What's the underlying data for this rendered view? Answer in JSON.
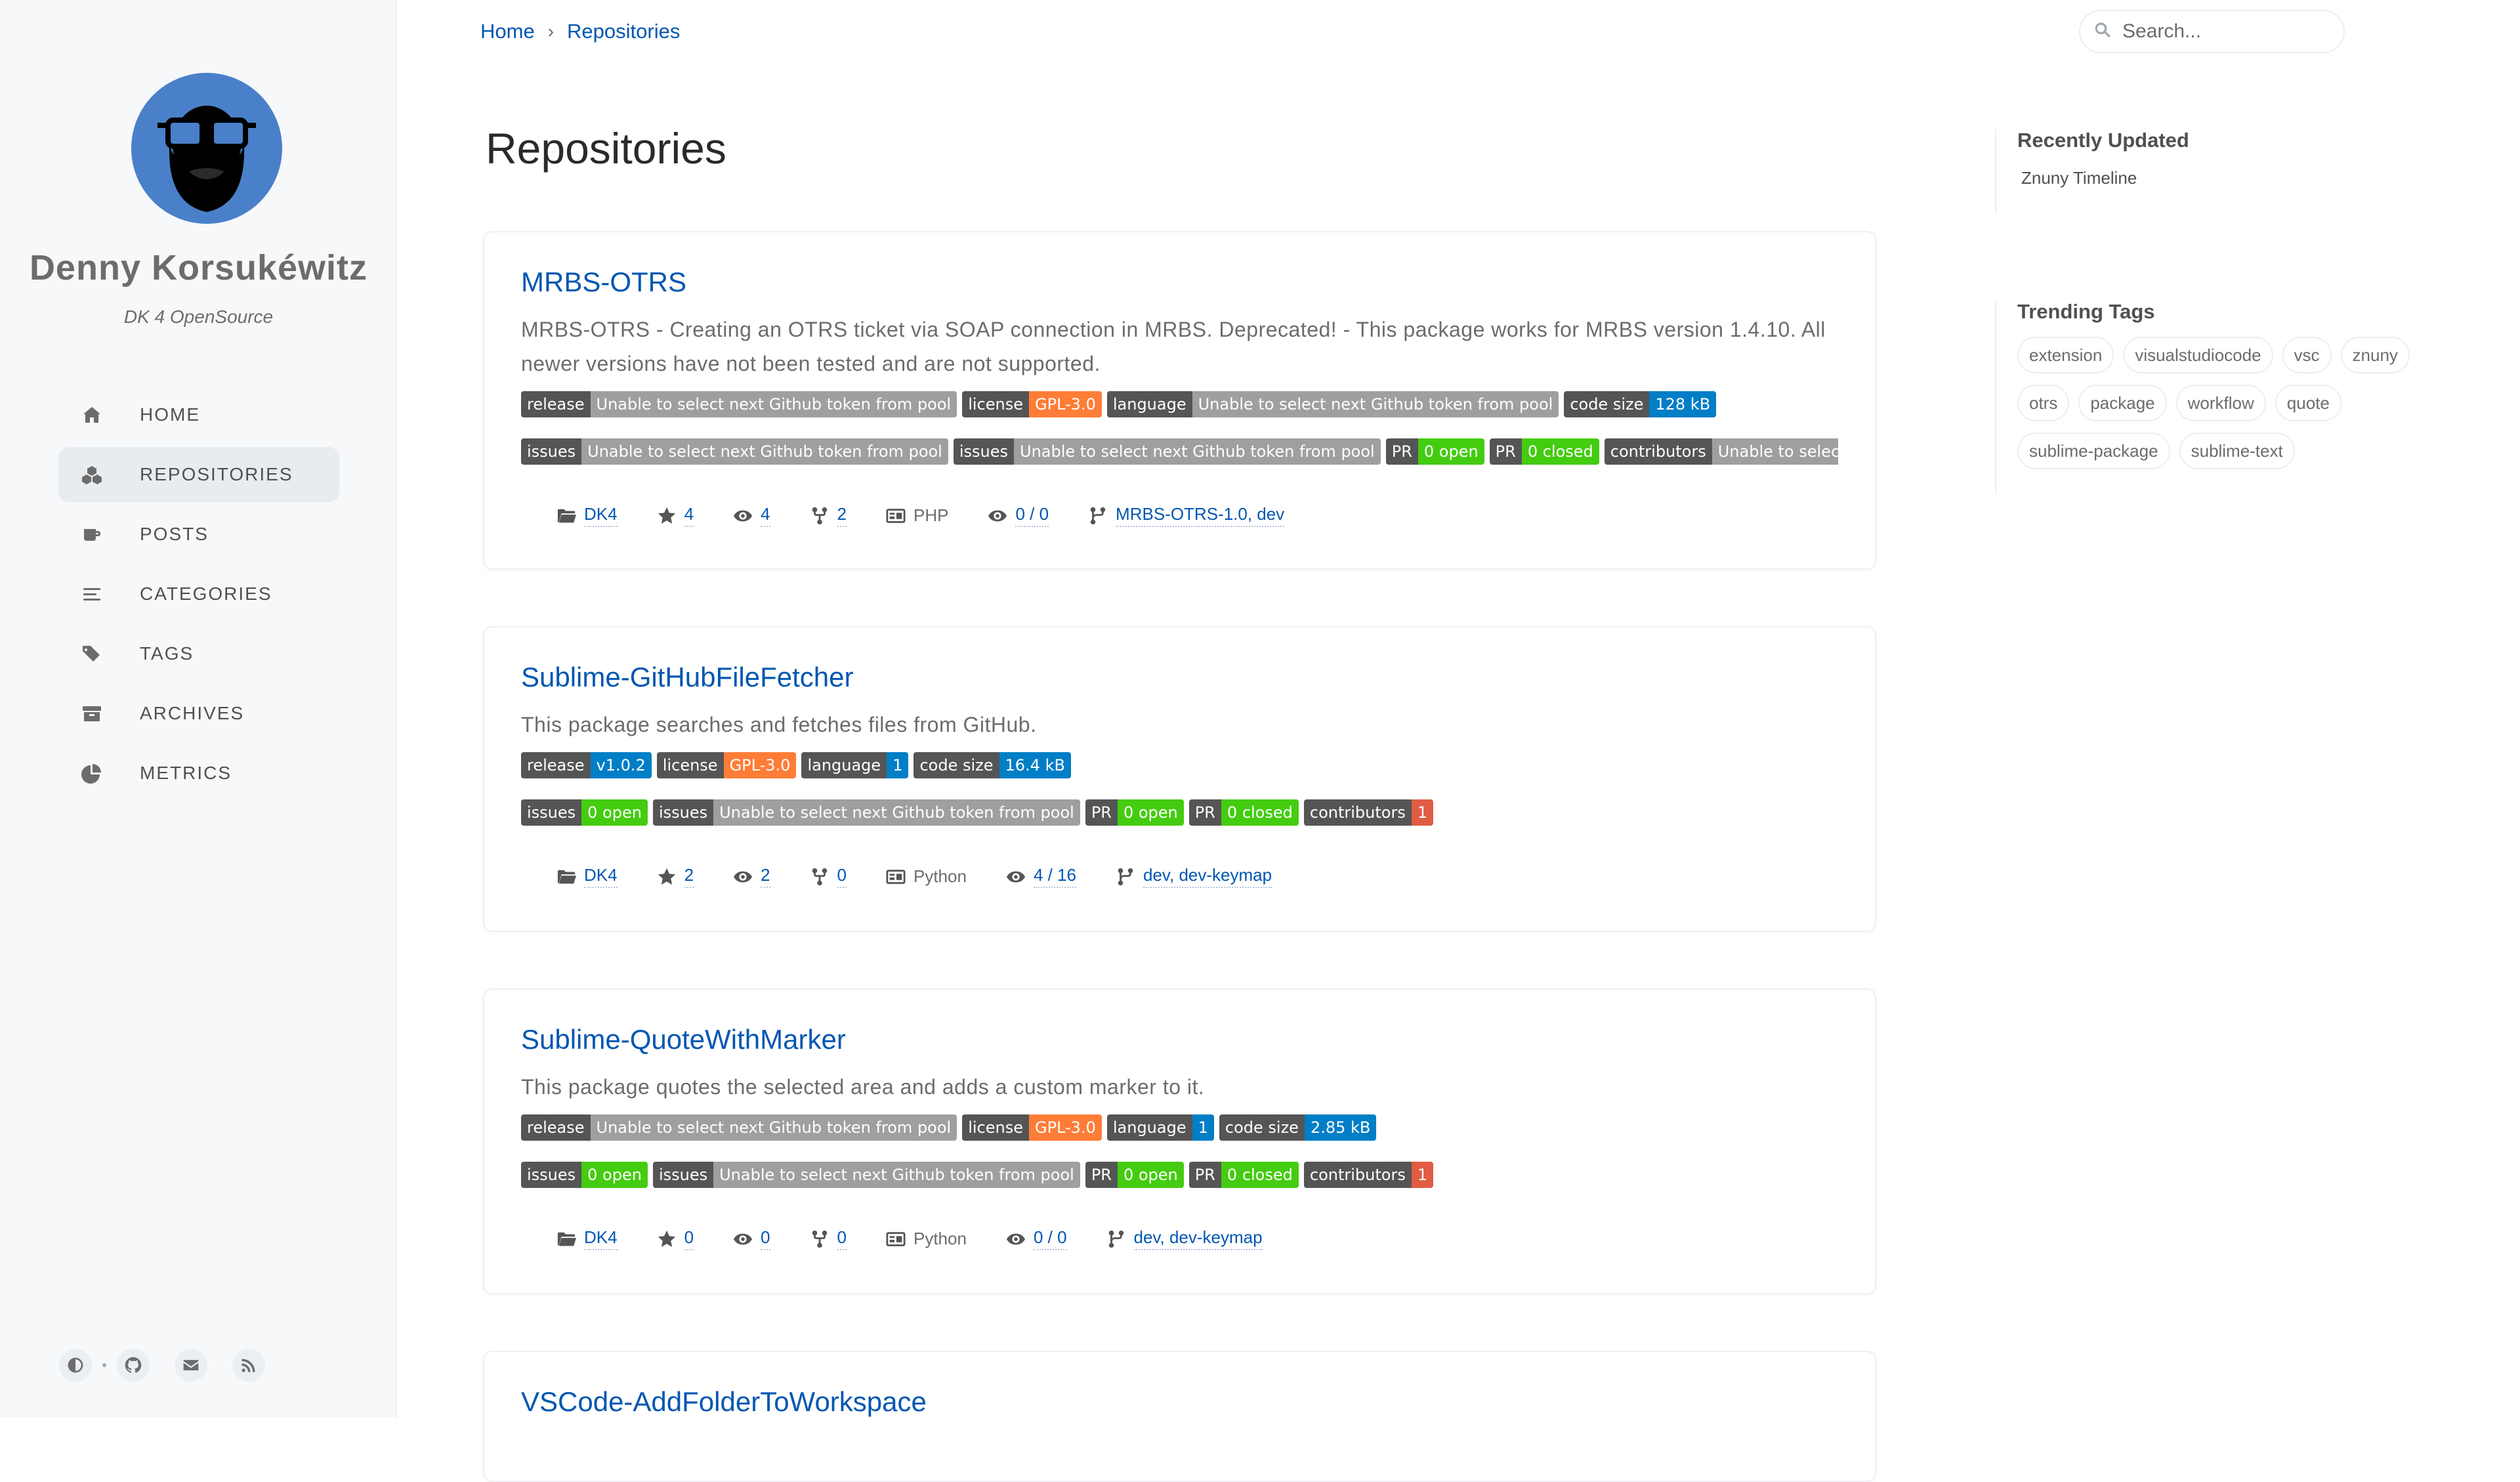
{
  "sidebar": {
    "title": "Denny Korsukéwitz",
    "subtitle": "DK 4 OpenSource",
    "nav": [
      {
        "label": "HOME",
        "icon": "home-icon"
      },
      {
        "label": "REPOSITORIES",
        "icon": "cubes-icon",
        "active": true
      },
      {
        "label": "POSTS",
        "icon": "coffee-icon"
      },
      {
        "label": "CATEGORIES",
        "icon": "stream-icon"
      },
      {
        "label": "TAGS",
        "icon": "tags-icon"
      },
      {
        "label": "ARCHIVES",
        "icon": "archive-icon"
      },
      {
        "label": "METRICS",
        "icon": "chart-pie-icon"
      }
    ],
    "bottom_icons": [
      "theme-toggle-icon",
      "github-icon",
      "email-icon",
      "rss-icon"
    ]
  },
  "breadcrumb": {
    "home": "Home",
    "current": "Repositories",
    "separator": "›"
  },
  "search": {
    "placeholder": "Search..."
  },
  "page_title": "Repositories",
  "repos": [
    {
      "name": "MRBS-OTRS",
      "description": "MRBS-OTRS - Creating an OTRS ticket via SOAP connection in MRBS. Deprecated! - This package works for MRBS version 1.4.10. All newer versions have not been tested and are not supported.",
      "badges_row1": [
        {
          "label": "release",
          "value": "Unable to select next Github token from pool",
          "color": "grey"
        },
        {
          "label": "license",
          "value": "GPL-3.0",
          "color": "orange"
        },
        {
          "label": "language",
          "value": "Unable to select next Github token from pool",
          "color": "grey"
        },
        {
          "label": "code size",
          "value": "128 kB",
          "color": "blue"
        }
      ],
      "badges_row2": [
        {
          "label": "issues",
          "value": "Unable to select next Github token from pool",
          "color": "grey"
        },
        {
          "label": "issues",
          "value": "Unable to select next Github token from pool",
          "color": "grey"
        },
        {
          "label": "PR",
          "value": "0 open",
          "color": "green"
        },
        {
          "label": "PR",
          "value": "0 closed",
          "color": "green"
        },
        {
          "label": "contributors",
          "value": "Unable to select next Github token from pool",
          "color": "grey"
        }
      ],
      "owner": "DK4",
      "stars": "4",
      "watchers": "4",
      "forks": "2",
      "language": "PHP",
      "views": "0 / 0",
      "branches": "MRBS-OTRS-1.0, dev"
    },
    {
      "name": "Sublime-GitHubFileFetcher",
      "description": "This package searches and fetches files from GitHub.",
      "badges_row1": [
        {
          "label": "release",
          "value": "v1.0.2",
          "color": "blue"
        },
        {
          "label": "license",
          "value": "GPL-3.0",
          "color": "orange"
        },
        {
          "label": "language",
          "value": "1",
          "color": "blue"
        },
        {
          "label": "code size",
          "value": "16.4 kB",
          "color": "blue"
        }
      ],
      "badges_row2": [
        {
          "label": "issues",
          "value": "0 open",
          "color": "green"
        },
        {
          "label": "issues",
          "value": "Unable to select next Github token from pool",
          "color": "grey"
        },
        {
          "label": "PR",
          "value": "0 open",
          "color": "green"
        },
        {
          "label": "PR",
          "value": "0 closed",
          "color": "green"
        },
        {
          "label": "contributors",
          "value": "1",
          "color": "red"
        }
      ],
      "owner": "DK4",
      "stars": "2",
      "watchers": "2",
      "forks": "0",
      "language": "Python",
      "views": "4 / 16",
      "branches": "dev, dev-keymap"
    },
    {
      "name": "Sublime-QuoteWithMarker",
      "description": "This package quotes the selected area and adds a custom marker to it.",
      "badges_row1": [
        {
          "label": "release",
          "value": "Unable to select next Github token from pool",
          "color": "grey"
        },
        {
          "label": "license",
          "value": "GPL-3.0",
          "color": "orange"
        },
        {
          "label": "language",
          "value": "1",
          "color": "blue"
        },
        {
          "label": "code size",
          "value": "2.85 kB",
          "color": "blue"
        }
      ],
      "badges_row2": [
        {
          "label": "issues",
          "value": "0 open",
          "color": "green"
        },
        {
          "label": "issues",
          "value": "Unable to select next Github token from pool",
          "color": "grey"
        },
        {
          "label": "PR",
          "value": "0 open",
          "color": "green"
        },
        {
          "label": "PR",
          "value": "0 closed",
          "color": "green"
        },
        {
          "label": "contributors",
          "value": "1",
          "color": "red"
        }
      ],
      "owner": "DK4",
      "stars": "0",
      "watchers": "0",
      "forks": "0",
      "language": "Python",
      "views": "0 / 0",
      "branches": "dev, dev-keymap"
    },
    {
      "name": "VSCode-AddFolderToWorkspace"
    }
  ],
  "recently_updated": {
    "title": "Recently Updated",
    "items": [
      "Znuny Timeline"
    ]
  },
  "trending_tags": {
    "title": "Trending Tags",
    "tags": [
      "extension",
      "visualstudiocode",
      "vsc",
      "znuny",
      "otrs",
      "package",
      "workflow",
      "quote",
      "sublime-package",
      "sublime-text"
    ]
  },
  "colors": {
    "link": "#0056b2",
    "sidebar_bg": "#f6f8fa",
    "badge_label": "#555555",
    "badge_grey": "#9f9f9f",
    "badge_orange": "#fe7d37",
    "badge_blue": "#007ec6",
    "badge_green": "#44cc11",
    "badge_red": "#e05d44"
  }
}
